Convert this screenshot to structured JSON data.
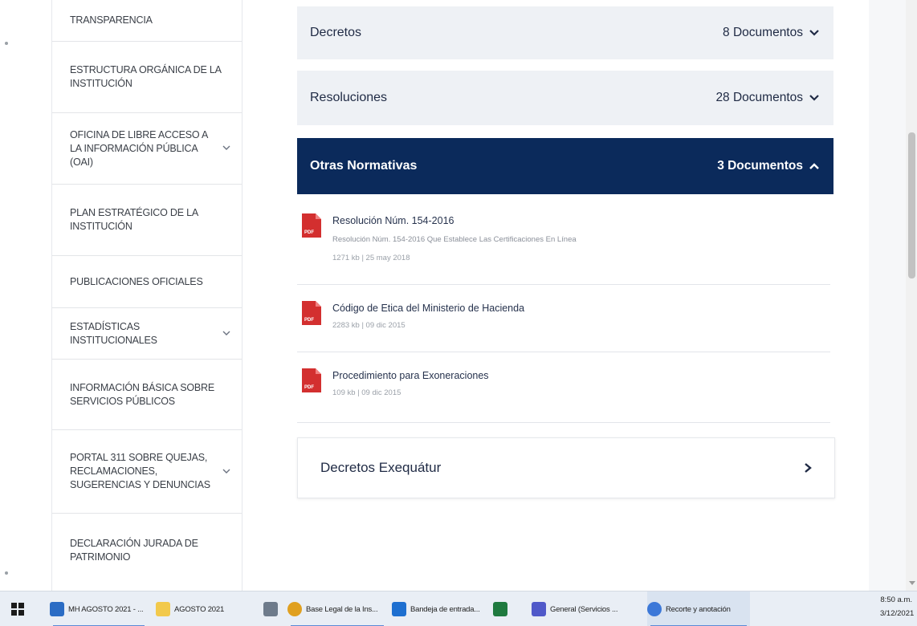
{
  "sidebar": {
    "items": [
      {
        "label": "TRANSPARENCIA",
        "chevron": false
      },
      {
        "label": "ESTRUCTURA ORGÁNICA DE LA INSTITUCIÓN",
        "chevron": false
      },
      {
        "label": "OFICINA DE LIBRE ACCESO A LA INFORMACIÓN PÚBLICA (OAI)",
        "chevron": true
      },
      {
        "label": "PLAN ESTRATÉGICO DE LA INSTITUCIÓN",
        "chevron": false
      },
      {
        "label": "PUBLICACIONES OFICIALES",
        "chevron": false
      },
      {
        "label": "ESTADÍSTICAS INSTITUCIONALES",
        "chevron": true
      },
      {
        "label": "INFORMACIÓN BÁSICA SOBRE SERVICIOS PÚBLICOS",
        "chevron": false
      },
      {
        "label": "PORTAL 311 SOBRE QUEJAS, RECLAMACIONES, SUGERENCIAS Y DENUNCIAS",
        "chevron": true
      },
      {
        "label": "DECLARACIÓN JURADA DE PATRIMONIO",
        "chevron": false
      }
    ]
  },
  "main": {
    "accordions": [
      {
        "title": "Decretos",
        "count": "8 Documentos",
        "expanded": false
      },
      {
        "title": "Resoluciones",
        "count": "28 Documentos",
        "expanded": false
      },
      {
        "title": "Otras Normativas",
        "count": "3 Documentos",
        "expanded": true
      }
    ],
    "documents": [
      {
        "title": "Resolución Núm. 154-2016",
        "description": "Resolución Núm. 154-2016 Que Establece Las Certificaciones En Línea",
        "meta": "1271 kb | 25 may 2018",
        "icon_label": "PDF"
      },
      {
        "title": "Código de Etica del Ministerio de Hacienda",
        "description": "",
        "meta": "2283 kb | 09 dic 2015",
        "icon_label": "PDF"
      },
      {
        "title": "Procedimiento para Exoneraciones",
        "description": "",
        "meta": "109 kb | 09 dic 2015",
        "icon_label": "PDF"
      }
    ],
    "card": {
      "title": "Decretos Exequátur"
    }
  },
  "taskbar": {
    "items": [
      {
        "label": "MH AGOSTO 2021 - ...",
        "icon_color": "#2b6cc4"
      },
      {
        "label": "AGOSTO 2021",
        "icon_color": "#f2c94c"
      },
      {
        "label": "",
        "icon_color": "#6e7b8b"
      },
      {
        "label": "Base Legal de la Ins...",
        "icon_color": "#e0a020"
      },
      {
        "label": "Bandeja de entrada...",
        "icon_color": "#1e6fd0"
      },
      {
        "label": "",
        "icon_color": "#1f7a3f"
      },
      {
        "label": "General (Servicios ...",
        "icon_color": "#5059c9"
      },
      {
        "label": "Recorte y anotación",
        "icon_color": "#3c78d8"
      }
    ],
    "clock_time": "8:50 a.m.",
    "clock_date": "3/12/2021"
  },
  "colors": {
    "navy": "#0b2a5b",
    "light_panel": "#eef1f5",
    "pdf_red": "#d32f2f"
  }
}
